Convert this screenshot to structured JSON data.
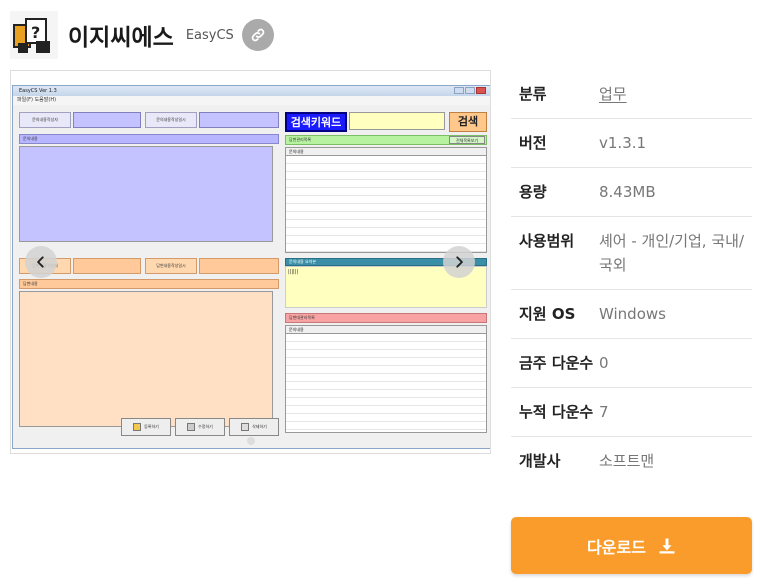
{
  "app": {
    "title": "이지씨에스",
    "subtitle": "EasyCS"
  },
  "screenshot": {
    "window_title": "EasyCS Ver 1.3",
    "menu": "파일(F)   도움말(H)",
    "left_top_labels": [
      "문의내용작성자",
      "문의내용작성일시"
    ],
    "left_top_bar": "문의내용",
    "left_mid_labels": [
      "답변내용작성자",
      "답변내용작성일시"
    ],
    "left_mid_bar": "답변내용",
    "search_label": "검색키워드",
    "search_button": "검색",
    "right_top_bar": "답변관리목록",
    "right_top_small_btn": "전체목록보기",
    "right_top_list_header": "문의내용",
    "right_mid_bar": "문의내용 요약본",
    "right_mid_content": "||||||",
    "right_bottom_bar": "답변대관리목록",
    "right_bottom_list_header": "문의내용",
    "bottom_buttons": [
      "등록하기",
      "수정하기",
      "삭제하기"
    ]
  },
  "info": {
    "rows": [
      {
        "key": "분류",
        "value": "업무"
      },
      {
        "key": "버전",
        "value": "v1.3.1"
      },
      {
        "key": "용량",
        "value": "8.43MB"
      },
      {
        "key": "사용범위",
        "value": "셰어 - 개인/기업, 국내/국외"
      },
      {
        "key": "지원 OS",
        "value": "Windows"
      },
      {
        "key": "금주 다운수",
        "value": "0"
      },
      {
        "key": "누적 다운수",
        "value": "7"
      },
      {
        "key": "개발사",
        "value": "소프트맨"
      }
    ]
  },
  "download": {
    "label": "다운로드"
  },
  "colors": {
    "accent": "#f99c2c",
    "link_button": "#aaaaaa"
  }
}
